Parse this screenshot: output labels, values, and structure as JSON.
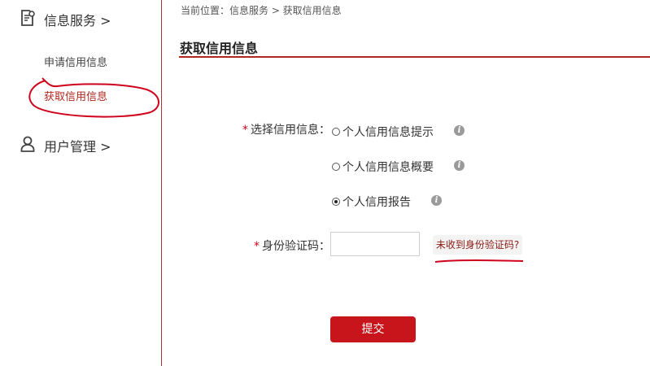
{
  "sidebar": {
    "groups": [
      {
        "label": "信息服务 >",
        "icon": "document-icon",
        "items": [
          {
            "label": "申请信用信息"
          },
          {
            "label": "获取信用信息",
            "active": true
          }
        ]
      },
      {
        "label": "用户管理 >",
        "icon": "user-icon",
        "items": []
      }
    ]
  },
  "breadcrumb": "当前位置：信息服务 > 获取信用信息",
  "page_title": "获取信用信息",
  "form": {
    "select_label": "选择信用信息：",
    "required_mark": "*",
    "options": [
      {
        "label": "个人信用信息提示",
        "checked": false
      },
      {
        "label": "个人信用信息概要",
        "checked": false
      },
      {
        "label": "个人信用报告",
        "checked": true
      }
    ],
    "code_label": "身份验证码：",
    "code_value": "",
    "resend_label": "未收到身份验证码?",
    "submit_label": "提交"
  },
  "colors": {
    "accent": "#b3261e",
    "submit_bg": "#c8141b",
    "annotation": "#d0021b"
  }
}
